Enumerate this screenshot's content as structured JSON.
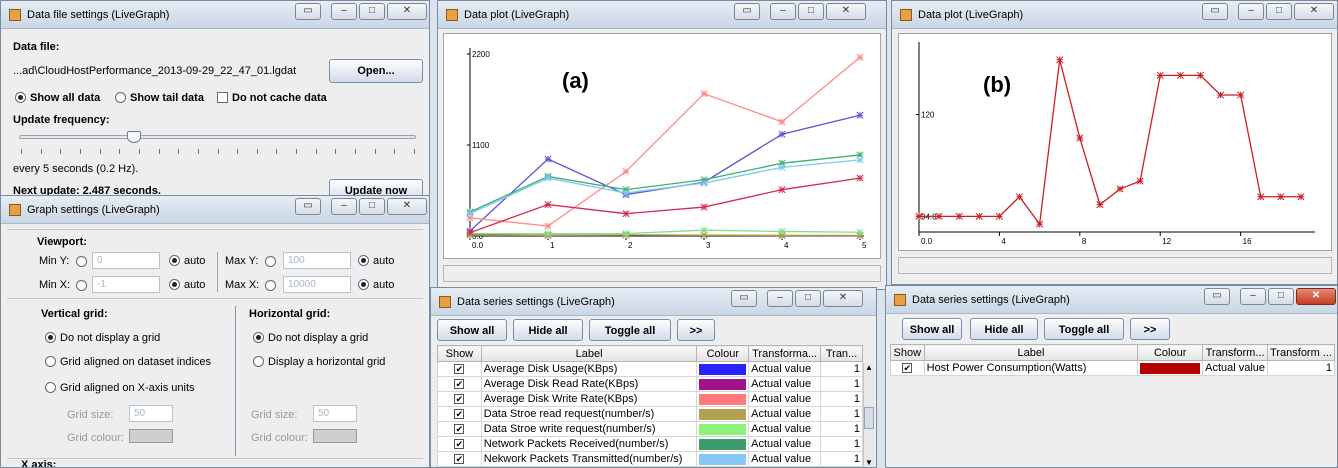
{
  "data_file_window": {
    "title": "Data file settings (LiveGraph)",
    "data_file_label": "Data file:",
    "file_path": "...ad\\CloudHostPerformance_2013-09-29_22_47_01.lgdat",
    "open_button": "Open...",
    "show_all_data": "Show all data",
    "show_tail_data": "Show tail data",
    "do_not_cache": "Do not cache data",
    "update_frequency_label": "Update frequency:",
    "frequency_text": "every 5 seconds (0.2 Hz).",
    "next_update": "Next update: 2.487 seconds.",
    "update_now_button": "Update now",
    "slider_level_fraction": 0.29
  },
  "graph_settings_window": {
    "title": "Graph settings (LiveGraph)",
    "viewport_label": "Viewport:",
    "min_y_label": "Min Y:",
    "min_y_value": "0",
    "min_x_label": "Min X:",
    "min_x_value": "-1",
    "max_y_label": "Max Y:",
    "max_y_value": "100",
    "max_x_label": "Max X:",
    "max_x_value": "10000",
    "auto_label": "auto",
    "vertical_grid_label": "Vertical grid:",
    "vertical_options": [
      "Do not display a grid",
      "Grid aligned on dataset indices",
      "Grid aligned on X-axis units"
    ],
    "horizontal_grid_label": "Horizontal grid:",
    "horizontal_options": [
      "Do not display a grid",
      "Display a horizontal grid"
    ],
    "grid_size_label": "Grid size:",
    "grid_size_value": "50",
    "grid_colour_label": "Grid colour:",
    "x_axis_label": "X axis:"
  },
  "plot_a": {
    "title": "Data plot (LiveGraph)",
    "panel_label": "(a)",
    "chart_data": {
      "type": "line",
      "x_ticks": [
        "0.0",
        "1",
        "2",
        "3",
        "4",
        "5"
      ],
      "y_ticks": [
        "0.0",
        "1100",
        "2200"
      ],
      "x": [
        0,
        1,
        2,
        3,
        4,
        5
      ],
      "ylim": [
        0,
        2200
      ],
      "grid": false,
      "series": [
        {
          "color": "#5b55d6",
          "values": [
            60,
            930,
            500,
            650,
            1230,
            1460
          ]
        },
        {
          "color": "#b02e8c",
          "values": [
            25,
            6,
            12,
            10,
            5,
            4
          ]
        },
        {
          "color": "#ff8a8a",
          "values": [
            220,
            120,
            780,
            1720,
            1380,
            2160
          ]
        },
        {
          "color": "#a8a040",
          "values": [
            10,
            10,
            12,
            10,
            8,
            8
          ]
        },
        {
          "color": "#7ee08a",
          "values": [
            30,
            28,
            30,
            70,
            55,
            45
          ]
        },
        {
          "color": "#3fae6e",
          "values": [
            290,
            720,
            560,
            680,
            880,
            980
          ]
        },
        {
          "color": "#7ec8f0",
          "values": [
            270,
            700,
            520,
            640,
            830,
            920
          ]
        },
        {
          "color": "#d62a50",
          "values": [
            40,
            380,
            270,
            350,
            560,
            700
          ]
        }
      ]
    }
  },
  "plot_b": {
    "title": "Data plot (LiveGraph)",
    "panel_label": "(b)",
    "chart_data": {
      "type": "line",
      "x_ticks": [
        "0.0",
        "4",
        "8",
        "12",
        "16"
      ],
      "y_ticks": [
        "94.0",
        "120"
      ],
      "x": [
        0,
        1,
        2,
        3,
        4,
        5,
        6,
        7,
        8,
        9,
        10,
        11,
        12,
        13,
        14,
        15,
        16,
        17,
        18,
        19
      ],
      "xlim": [
        0,
        19.5
      ],
      "ylim": [
        90,
        137
      ],
      "grid": false,
      "series": [
        {
          "color": "#cc1f1f",
          "values": [
            94,
            94,
            94,
            94,
            94,
            99,
            92,
            134,
            114,
            97,
            101,
            103,
            130,
            130,
            130,
            125,
            125,
            99,
            99,
            99
          ]
        }
      ]
    }
  },
  "series_window_a": {
    "title": "Data series settings (LiveGraph)",
    "buttons": [
      "Show all",
      "Hide all",
      "Toggle all",
      ">>"
    ],
    "columns": [
      "Show",
      "Label",
      "Colour",
      "Transforma...",
      "Tran..."
    ],
    "rows": [
      {
        "label": "Average Disk Usage(KBps)",
        "color": "#2a22ff",
        "transform": "Actual value",
        "param": "1"
      },
      {
        "label": "Average Disk Read Rate(KBps)",
        "color": "#a0128c",
        "transform": "Actual value",
        "param": "1"
      },
      {
        "label": "Average Disk Write Rate(KBps)",
        "color": "#ff7a7a",
        "transform": "Actual value",
        "param": "1"
      },
      {
        "label": "Data Stroe read request(number/s)",
        "color": "#b3a050",
        "transform": "Actual value",
        "param": "1"
      },
      {
        "label": "Data Stroe write request(number/s)",
        "color": "#8cf27a",
        "transform": "Actual value",
        "param": "1"
      },
      {
        "label": "Network Packets Received(number/s)",
        "color": "#3a9e6a",
        "transform": "Actual value",
        "param": "1"
      },
      {
        "label": "Nekwork Packets Transmitted(number/s)",
        "color": "#86c8f2",
        "transform": "Actual value",
        "param": "1"
      }
    ]
  },
  "series_window_b": {
    "title": "Data series settings (LiveGraph)",
    "buttons": [
      "Show all",
      "Hide all",
      "Toggle all",
      ">>"
    ],
    "columns": [
      "Show",
      "Label",
      "Colour",
      "Transform...",
      "Transform ..."
    ],
    "rows": [
      {
        "label": "Host Power Consumption(Watts)",
        "color": "#b40000",
        "transform": "Actual value",
        "param": "1"
      }
    ]
  }
}
